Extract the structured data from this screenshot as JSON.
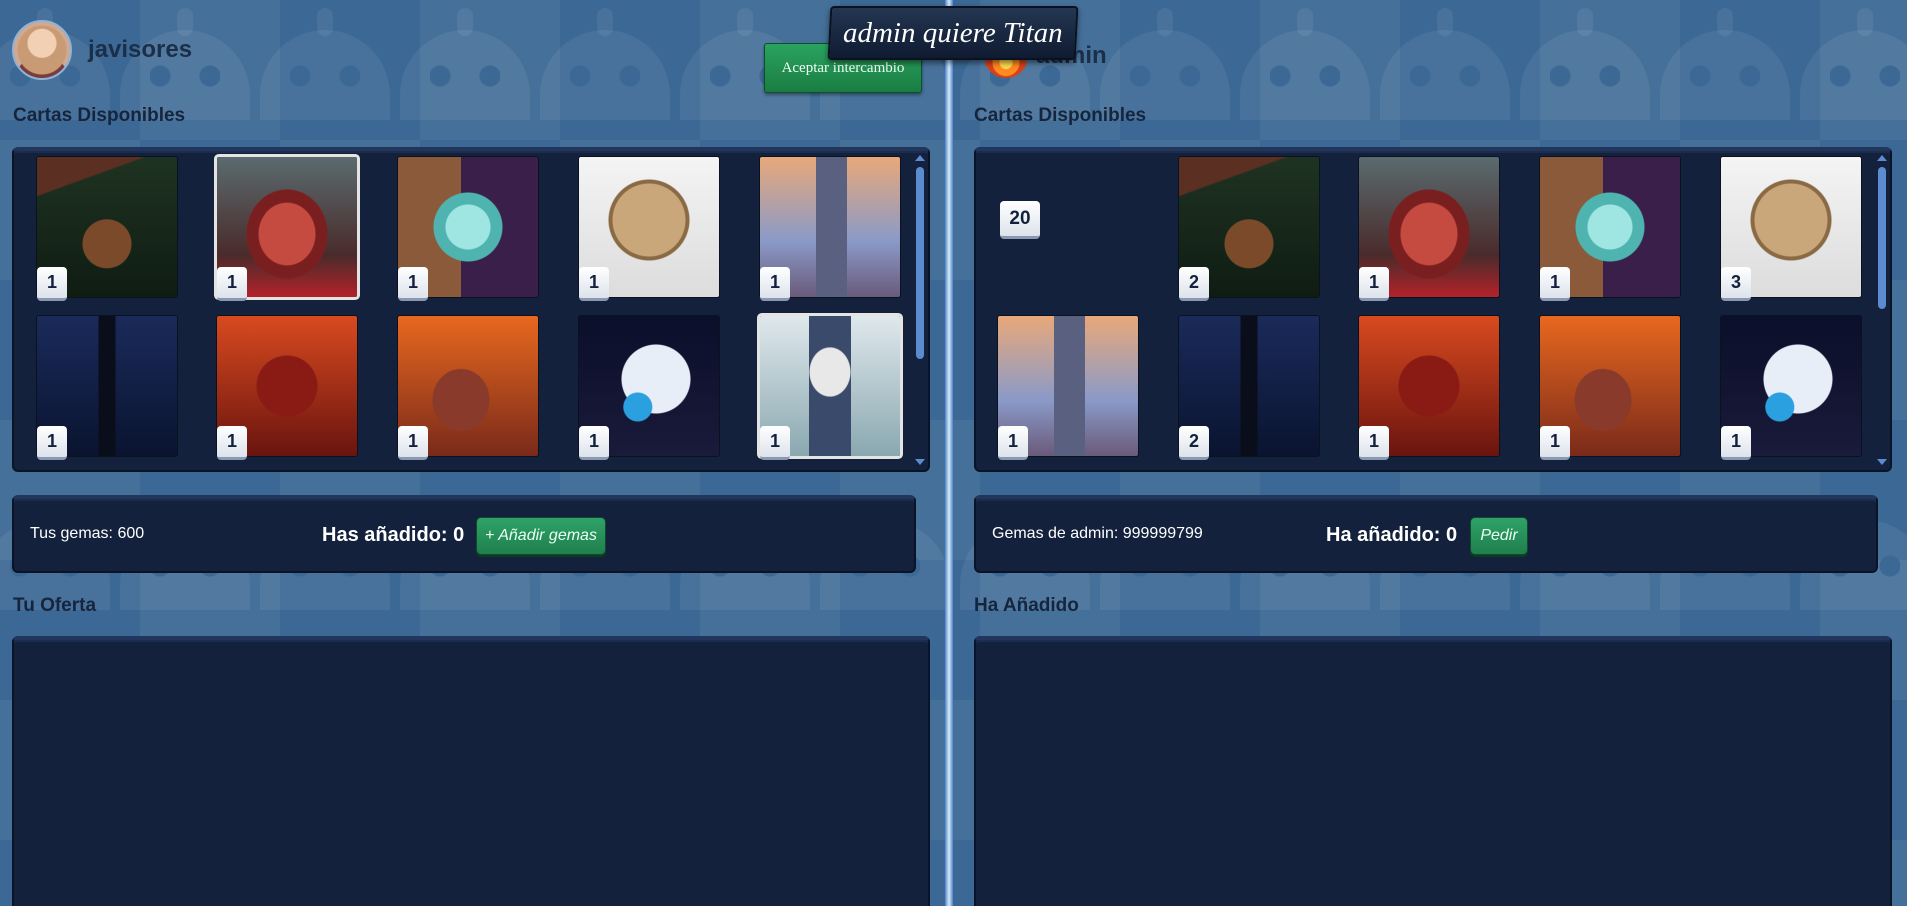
{
  "banner": "admin quiere Titan",
  "accept_button": "Aceptar intercambio",
  "left": {
    "username": "javisores",
    "avatar": "bearded-man-avatar",
    "available_title": "Cartas Disponibles",
    "cards": [
      {
        "art": "wizard-creature-forest",
        "count": "1"
      },
      {
        "art": "red-titan-forest",
        "count": "1",
        "selected": true
      },
      {
        "art": "cyan-robot-door",
        "count": "1"
      },
      {
        "art": "round-steampunk-robot",
        "count": "1"
      },
      {
        "art": "giant-mech-sunset",
        "count": "1"
      },
      {
        "art": "shadow-figure-night",
        "count": "1"
      },
      {
        "art": "red-demon-fire",
        "count": "1"
      },
      {
        "art": "demon-volcano",
        "count": "1"
      },
      {
        "art": "ghost-orb",
        "count": "1"
      },
      {
        "art": "white-haired-samurai",
        "count": "1",
        "selected": true
      }
    ],
    "gems_label": "Tus gemas: 600",
    "added_label": "Has añadido: 0",
    "add_gems_button": "+ Añadir gemas",
    "offer_title": "Tu Oferta"
  },
  "right": {
    "username": "admin",
    "avatar": "fire-avatar",
    "available_title": "Cartas Disponibles",
    "stack_count": "20",
    "cards": [
      {
        "art": "wizard-creature-forest",
        "count": "2"
      },
      {
        "art": "red-titan-forest",
        "count": "1"
      },
      {
        "art": "cyan-robot-door",
        "count": "1"
      },
      {
        "art": "round-steampunk-robot",
        "count": "3"
      },
      {
        "art": "giant-mech-sunset",
        "count": "1"
      },
      {
        "art": "shadow-figure-night",
        "count": "2"
      },
      {
        "art": "red-demon-fire",
        "count": "1"
      },
      {
        "art": "demon-volcano",
        "count": "1"
      },
      {
        "art": "ghost-orb",
        "count": "1"
      }
    ],
    "gems_label": "Gemas de admin: 999999799",
    "added_label": "Ha añadido: 0",
    "request_button": "Pedir",
    "offer_title": "Ha Añadido"
  },
  "colors": {
    "panel": "#13213d",
    "background": "#3b6894",
    "button_green": "#1f7f4d"
  }
}
